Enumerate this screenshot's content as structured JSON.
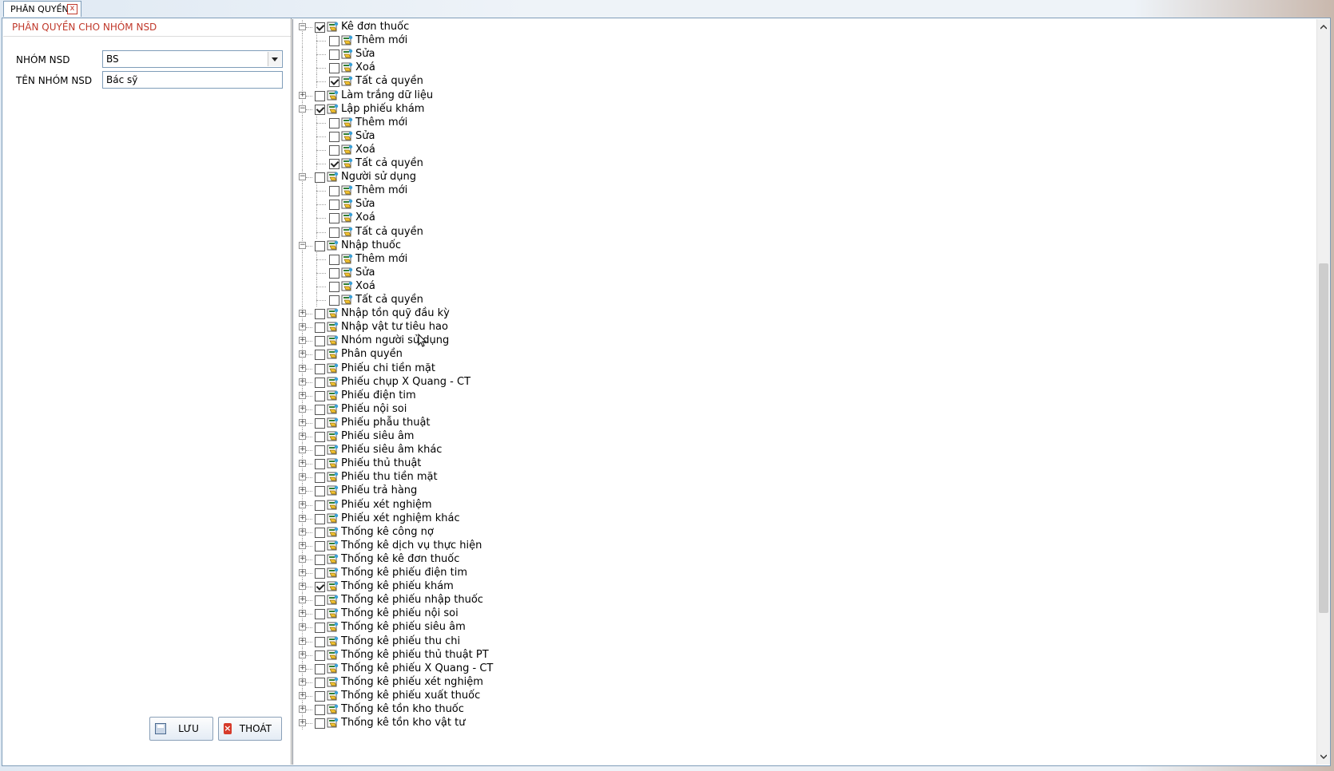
{
  "tab": {
    "title": "PHÂN QUYỀN",
    "close": "x"
  },
  "panel": {
    "title": "PHÂN QUYỀN CHO NHÓM NSD",
    "group_label": "NHÓM NSD",
    "group_value": "BS",
    "name_label": "TÊN NHÓM NSD",
    "name_value": "Bác sỹ"
  },
  "buttons": {
    "save": "LƯU",
    "exit": "THOÁT"
  },
  "tree": [
    {
      "level": 0,
      "label": "Kê đơn thuốc",
      "checked": true,
      "expanded": true
    },
    {
      "level": 1,
      "label": "Thêm mới",
      "checked": false
    },
    {
      "level": 1,
      "label": "Sửa",
      "checked": false
    },
    {
      "level": 1,
      "label": "Xoá",
      "checked": false
    },
    {
      "level": 1,
      "label": "Tất cả quyền",
      "checked": true
    },
    {
      "level": 0,
      "label": "Làm trắng dữ liệu",
      "checked": false,
      "expanded": false
    },
    {
      "level": 0,
      "label": "Lập phiếu khám",
      "checked": true,
      "expanded": true
    },
    {
      "level": 1,
      "label": "Thêm mới",
      "checked": false
    },
    {
      "level": 1,
      "label": "Sửa",
      "checked": false
    },
    {
      "level": 1,
      "label": "Xoá",
      "checked": false
    },
    {
      "level": 1,
      "label": "Tất cả quyền",
      "checked": true
    },
    {
      "level": 0,
      "label": "Người sử dụng",
      "checked": false,
      "expanded": true
    },
    {
      "level": 1,
      "label": "Thêm mới",
      "checked": false
    },
    {
      "level": 1,
      "label": "Sửa",
      "checked": false
    },
    {
      "level": 1,
      "label": "Xoá",
      "checked": false
    },
    {
      "level": 1,
      "label": "Tất cả quyền",
      "checked": false
    },
    {
      "level": 0,
      "label": "Nhập thuốc",
      "checked": false,
      "expanded": true
    },
    {
      "level": 1,
      "label": "Thêm mới",
      "checked": false
    },
    {
      "level": 1,
      "label": "Sửa",
      "checked": false
    },
    {
      "level": 1,
      "label": "Xoá",
      "checked": false
    },
    {
      "level": 1,
      "label": "Tất cả quyền",
      "checked": false
    },
    {
      "level": 0,
      "label": "Nhập tồn quỹ đầu kỳ",
      "checked": false,
      "expanded": false
    },
    {
      "level": 0,
      "label": "Nhập vật tư tiêu hao",
      "checked": false,
      "expanded": false
    },
    {
      "level": 0,
      "label": "Nhóm người sử dụng",
      "checked": false,
      "expanded": false
    },
    {
      "level": 0,
      "label": "Phân quyền",
      "checked": false,
      "expanded": false
    },
    {
      "level": 0,
      "label": "Phiếu chi tiền mặt",
      "checked": false,
      "expanded": false
    },
    {
      "level": 0,
      "label": "Phiếu chụp X Quang - CT",
      "checked": false,
      "expanded": false
    },
    {
      "level": 0,
      "label": "Phiếu điện tim",
      "checked": false,
      "expanded": false
    },
    {
      "level": 0,
      "label": "Phiếu nội soi",
      "checked": false,
      "expanded": false
    },
    {
      "level": 0,
      "label": "Phiếu phẫu thuật",
      "checked": false,
      "expanded": false
    },
    {
      "level": 0,
      "label": "Phiếu siêu âm",
      "checked": false,
      "expanded": false
    },
    {
      "level": 0,
      "label": "Phiếu siêu âm khác",
      "checked": false,
      "expanded": false
    },
    {
      "level": 0,
      "label": "Phiếu thủ thuật",
      "checked": false,
      "expanded": false
    },
    {
      "level": 0,
      "label": "Phiếu thu tiền mặt",
      "checked": false,
      "expanded": false
    },
    {
      "level": 0,
      "label": "Phiếu trả hàng",
      "checked": false,
      "expanded": false
    },
    {
      "level": 0,
      "label": "Phiếu xét nghiệm",
      "checked": false,
      "expanded": false
    },
    {
      "level": 0,
      "label": "Phiếu xét nghiệm khác",
      "checked": false,
      "expanded": false
    },
    {
      "level": 0,
      "label": "Thống kê công nợ",
      "checked": false,
      "expanded": false
    },
    {
      "level": 0,
      "label": "Thống kê dịch vụ thực hiện",
      "checked": false,
      "expanded": false
    },
    {
      "level": 0,
      "label": "Thống kê kê đơn thuốc",
      "checked": false,
      "expanded": false
    },
    {
      "level": 0,
      "label": "Thống kê phiếu điện tim",
      "checked": false,
      "expanded": false
    },
    {
      "level": 0,
      "label": "Thống kê phiếu khám",
      "checked": true,
      "expanded": false
    },
    {
      "level": 0,
      "label": "Thống kê phiếu nhập thuốc",
      "checked": false,
      "expanded": false
    },
    {
      "level": 0,
      "label": "Thống kê phiếu nội soi",
      "checked": false,
      "expanded": false
    },
    {
      "level": 0,
      "label": "Thống kê phiếu siêu âm",
      "checked": false,
      "expanded": false
    },
    {
      "level": 0,
      "label": "Thống kê phiếu thu chi",
      "checked": false,
      "expanded": false
    },
    {
      "level": 0,
      "label": "Thống kê phiếu thủ thuật PT",
      "checked": false,
      "expanded": false
    },
    {
      "level": 0,
      "label": "Thống kê phiếu X Quang - CT",
      "checked": false,
      "expanded": false
    },
    {
      "level": 0,
      "label": "Thống kê phiếu xét nghiệm",
      "checked": false,
      "expanded": false
    },
    {
      "level": 0,
      "label": "Thống kê phiếu xuất thuốc",
      "checked": false,
      "expanded": false
    },
    {
      "level": 0,
      "label": "Thống kê tồn kho thuốc",
      "checked": false,
      "expanded": false
    },
    {
      "level": 0,
      "label": "Thống kê tồn kho vật tư",
      "checked": false,
      "expanded": false
    }
  ]
}
